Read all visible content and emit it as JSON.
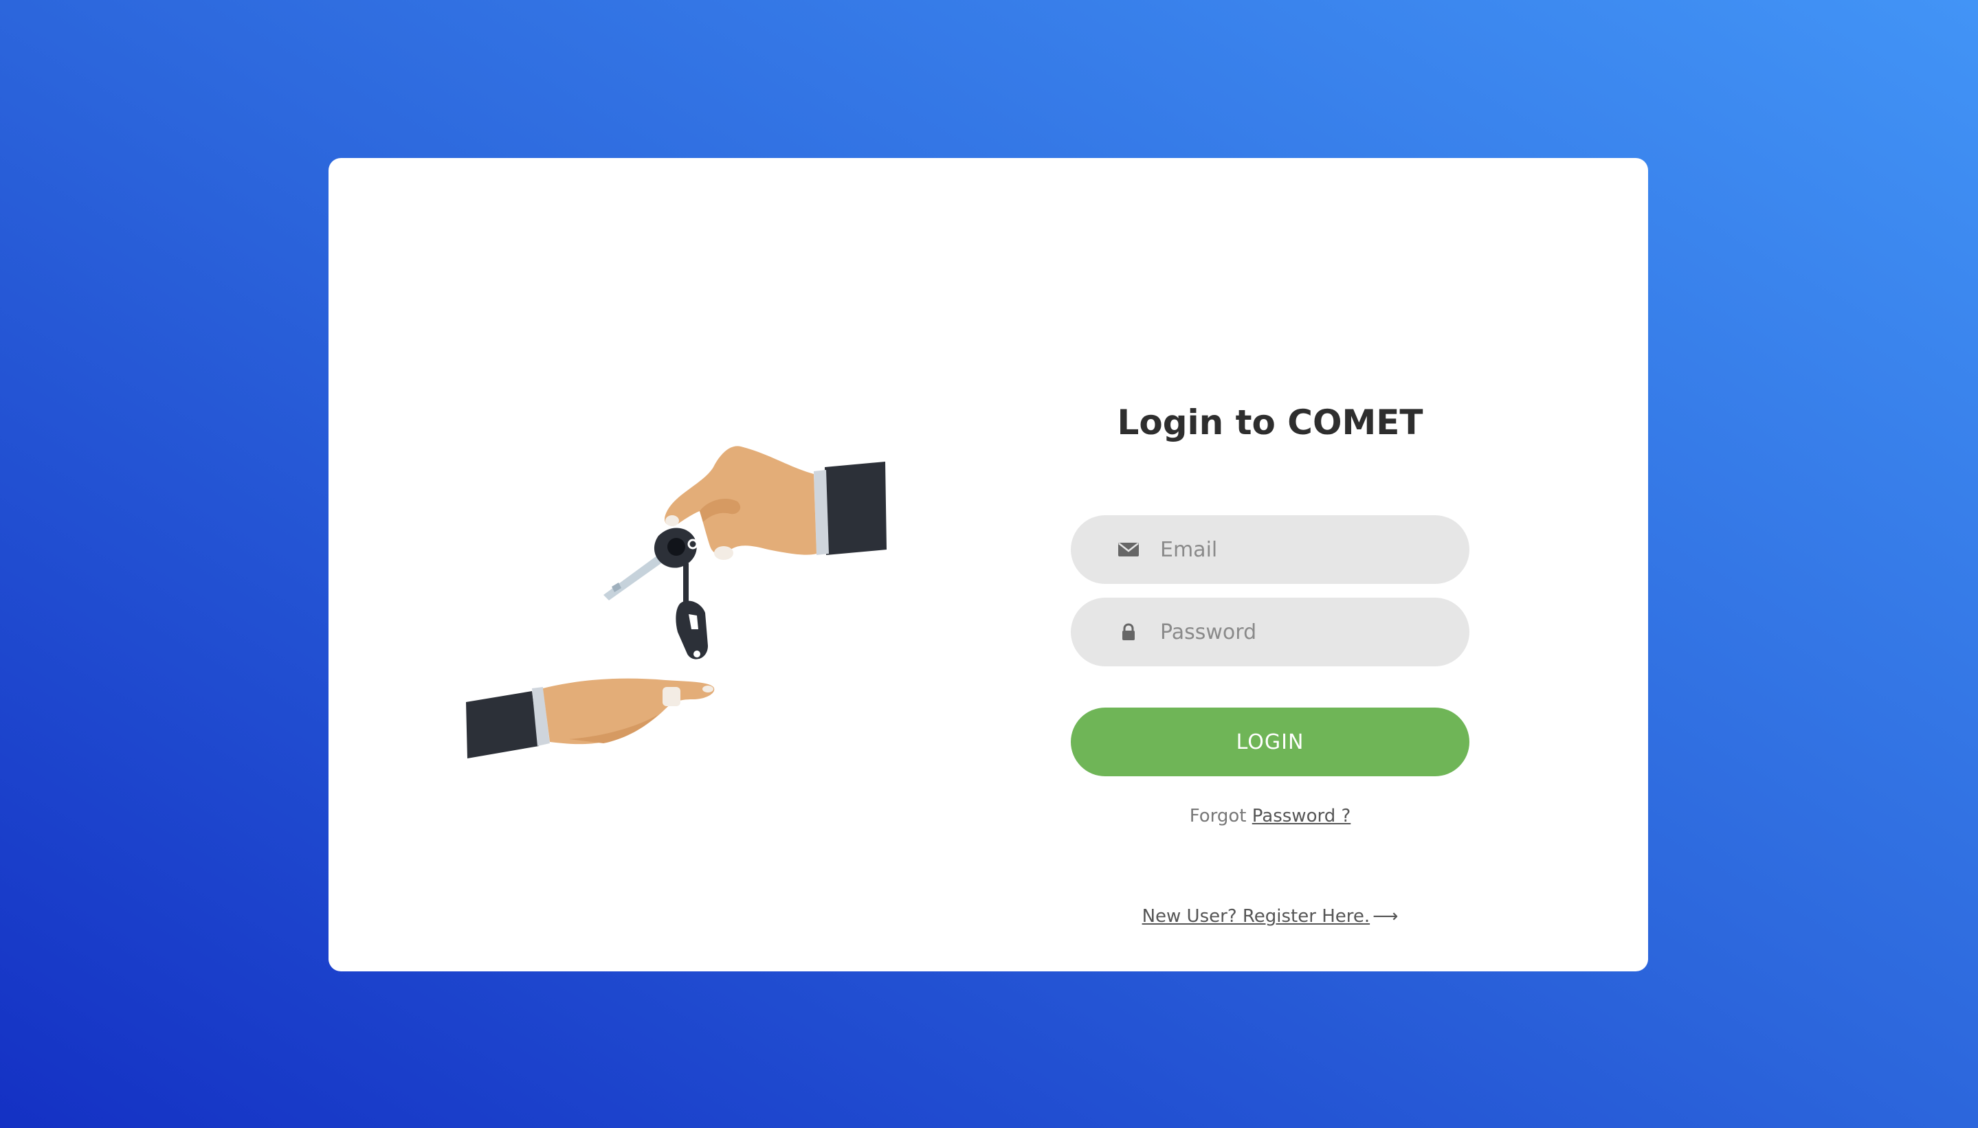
{
  "login": {
    "title": "Login to COMET",
    "email": {
      "placeholder": "Email",
      "icon": "envelope-icon"
    },
    "password": {
      "placeholder": "Password",
      "icon": "lock-icon"
    },
    "submit_label": "LOGIN",
    "forgot_prefix": "Forgot",
    "forgot_link": "Password ?",
    "register_link": "New User? Register Here.",
    "register_arrow": "⟶"
  },
  "colors": {
    "background_start": "#1431c4",
    "background_end": "#4294f6",
    "button": "#6fb557",
    "input_bg": "#e6e6e6",
    "title": "#2e2e2e"
  },
  "illustration": {
    "icon": "hands-passing-car-keys"
  }
}
